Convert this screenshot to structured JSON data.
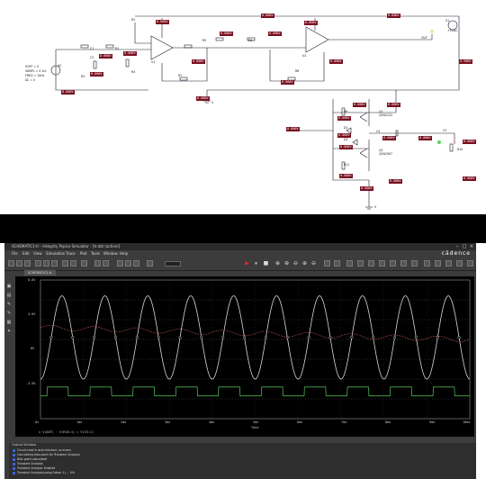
{
  "schematic": {
    "net_labels": [
      "0.000V",
      "0.000V",
      "0.000V",
      "4.966V",
      "0.000V",
      "0.000V",
      "0.000V",
      "0.000V",
      "0.000V",
      "0.000V",
      "0.000V",
      "0.000V",
      "0.000V",
      "0.000V",
      "0.000V",
      "0.000V",
      "0.000V",
      "0.000V",
      "0.000V",
      "0.000V",
      "0.000V",
      "0.000V",
      "0.000V",
      "0.000V",
      "0.000V",
      "0.000V",
      "0.000V",
      "0.000V"
    ],
    "source_params": [
      "VOFF = 0",
      "VAMPL = 0.1m",
      "FREQ = 1kHz",
      "AC = 0"
    ],
    "labels": {
      "v1": "V1",
      "v1_val": "+5VDC",
      "v2": "V2",
      "c1": "C1",
      "c2": "C2",
      "c3": "C3",
      "c4": "C4",
      "r1": "R1",
      "r2": "R2",
      "r3": "R3",
      "r4": "R4",
      "r5": "R5",
      "r6": "R6",
      "r7": "R7",
      "r8": "R8",
      "r9": "R9",
      "r10": "R10",
      "r11": "R11",
      "u1": "U1",
      "u2": "U2",
      "q1": "Q1",
      "q2": "Q2",
      "d1": "D1",
      "d2": "D2",
      "out": "OUT",
      "ground": "0",
      "q1_part": "Q2N2222",
      "q2_part": "Q2N2907"
    }
  },
  "sim": {
    "title": "SCHEMATIC1-tr - Integrity Pspice Simulator - [tr.dat (active)]",
    "brand": "cādence",
    "menu": [
      "File",
      "Edit",
      "View",
      "Simulation",
      "Trace",
      "Plot",
      "Tools",
      "Window",
      "Help"
    ],
    "tab": "SCHEMATIC1-tr",
    "plot": {
      "y_ticks": [
        "8.0V",
        "4.0V",
        "0V",
        "-4.0V"
      ],
      "x_ticks": [
        "0s",
        "1ms",
        "2ms",
        "3ms",
        "4ms",
        "5ms",
        "6ms",
        "7ms",
        "8ms",
        "9ms",
        "10ms"
      ],
      "x_label": "Time",
      "legend": "◇ V(OUT) ◦ V(R10:1) ○ V(C3:1)"
    },
    "output_window": {
      "title": "Output Window",
      "lines": [
        "Circuit read in and checked, no errors",
        "Calculating bias point for Transient Analysis",
        "Bias point calculated",
        "Transient Analysis",
        "Transient Analysis finished",
        "Transient Analysis(using Solver 1) ...  0%"
      ]
    }
  },
  "chart_data": {
    "type": "line",
    "xlabel": "Time",
    "ylabel": "",
    "x_unit": "ms",
    "xlim": [
      0,
      10
    ],
    "ylim": [
      -6,
      8
    ],
    "grid": true,
    "series": [
      {
        "name": "V(OUT)",
        "color": "#d8d8d8",
        "shape": "sine",
        "frequency_khz": 1,
        "amplitude_v": 4.2,
        "offset_v": 2.2,
        "phase_start": "low"
      },
      {
        "name": "V(R10:1)",
        "color": "#b85050",
        "shape": "line",
        "start_v": 3.2,
        "end_v": 2.0
      },
      {
        "name": "V(C3:1)",
        "color": "#4caf50",
        "shape": "square",
        "frequency_khz": 1,
        "high_v": -2.8,
        "low_v": -3.7
      }
    ]
  }
}
